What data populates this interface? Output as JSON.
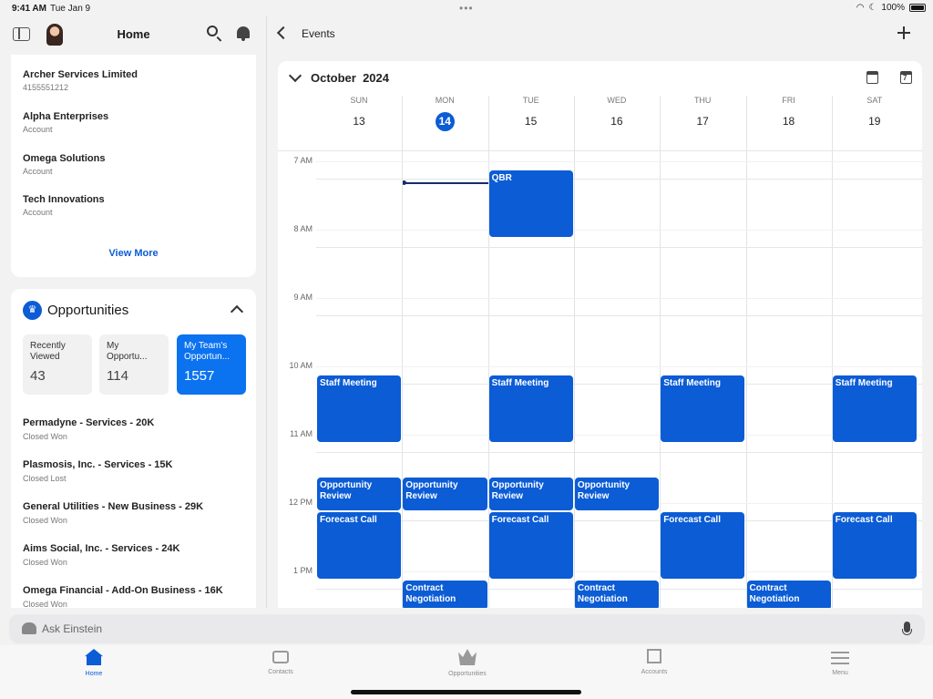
{
  "status": {
    "time": "9:41 AM",
    "date": "Tue Jan 9",
    "battery": "100%"
  },
  "left": {
    "title": "Home",
    "accounts": [
      {
        "name": "Archer Services Limited",
        "sub": "4155551212"
      },
      {
        "name": "Alpha Enterprises",
        "sub": "Account"
      },
      {
        "name": "Omega Solutions",
        "sub": "Account"
      },
      {
        "name": "Tech Innovations",
        "sub": "Account"
      }
    ],
    "view_more": "View More",
    "opportunities": {
      "title": "Opportunities",
      "icon": "crown-icon",
      "tiles": [
        {
          "label": "Recently Viewed",
          "count": "43"
        },
        {
          "label": "My Opportu...",
          "count": "114"
        },
        {
          "label": "My Team's Opportun...",
          "count": "1557"
        }
      ],
      "items": [
        {
          "name": "Permadyne - Services - 20K",
          "stage": "Closed Won"
        },
        {
          "name": "Plasmosis, Inc. - Services - 15K",
          "stage": "Closed Lost"
        },
        {
          "name": "General Utilities - New Business - 29K",
          "stage": "Closed Won"
        },
        {
          "name": "Aims Social, Inc. - Services - 24K",
          "stage": "Closed Won"
        },
        {
          "name": "Omega Financial - Add-On Business - 16K",
          "stage": "Closed Won"
        }
      ]
    }
  },
  "right": {
    "title": "Events",
    "month": "October  2024",
    "days": [
      {
        "name": "SUN",
        "date": "13"
      },
      {
        "name": "MON",
        "date": "14",
        "today": true
      },
      {
        "name": "TUE",
        "date": "15"
      },
      {
        "name": "WED",
        "date": "16"
      },
      {
        "name": "THU",
        "date": "17"
      },
      {
        "name": "FRI",
        "date": "18"
      },
      {
        "name": "SAT",
        "date": "19"
      }
    ],
    "hours": [
      "7 AM",
      "8 AM",
      "9 AM",
      "10 AM",
      "11 AM",
      "12 PM",
      "1 PM"
    ],
    "events": [
      {
        "title": "QBR",
        "day": 2,
        "start": 7.25,
        "end": 8.25
      },
      {
        "title": "Staff Meeting",
        "day": 0,
        "start": 10.25,
        "end": 11.25
      },
      {
        "title": "Staff Meeting",
        "day": 2,
        "start": 10.25,
        "end": 11.25
      },
      {
        "title": "Staff Meeting",
        "day": 4,
        "start": 10.25,
        "end": 11.25
      },
      {
        "title": "Staff Meeting",
        "day": 6,
        "start": 10.25,
        "end": 11.25
      },
      {
        "title": "Opportunity Review",
        "day": 0,
        "start": 11.75,
        "end": 12.25
      },
      {
        "title": "Opportunity Review",
        "day": 1,
        "start": 11.75,
        "end": 12.25
      },
      {
        "title": "Opportunity Review",
        "day": 2,
        "start": 11.75,
        "end": 12.25
      },
      {
        "title": "Opportunity Review",
        "day": 3,
        "start": 11.75,
        "end": 12.25
      },
      {
        "title": "Forecast Call",
        "day": 0,
        "start": 12.25,
        "end": 13.25
      },
      {
        "title": "Forecast Call",
        "day": 2,
        "start": 12.25,
        "end": 13.25
      },
      {
        "title": "Forecast Call",
        "day": 4,
        "start": 12.25,
        "end": 13.25
      },
      {
        "title": "Forecast Call",
        "day": 6,
        "start": 12.25,
        "end": 13.25
      },
      {
        "title": "Contract Negotiation",
        "day": 1,
        "start": 13.25,
        "end": 13.7
      },
      {
        "title": "Contract Negotiation",
        "day": 3,
        "start": 13.25,
        "end": 13.7
      },
      {
        "title": "Contract Negotiation",
        "day": 5,
        "start": 13.25,
        "end": 13.7
      }
    ]
  },
  "ask": {
    "placeholder": "Ask Einstein"
  },
  "tabs": [
    {
      "label": "Home",
      "icon": "home-icon",
      "active": true
    },
    {
      "label": "Contacts",
      "icon": "contacts-icon"
    },
    {
      "label": "Opportunities",
      "icon": "crown-icon"
    },
    {
      "label": "Accounts",
      "icon": "accounts-icon"
    },
    {
      "label": "Menu",
      "icon": "menu-icon"
    }
  ]
}
